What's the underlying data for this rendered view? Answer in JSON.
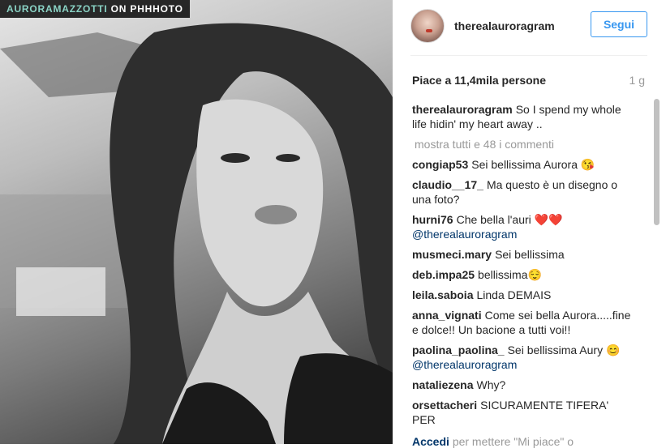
{
  "photo": {
    "overlay_tag_user": "AURORAMAZZOTTI",
    "overlay_tag_rest": "ON PHHHOTO"
  },
  "header": {
    "username": "therealauroragram",
    "follow_label": "Segui"
  },
  "likes": "Piace a 11,4mila persone",
  "time": "1 g",
  "caption": {
    "user": "therealauroragram",
    "text": "So I spend my whole life hidin' my heart away .."
  },
  "show_all": "mostra tutti e 48 i commenti",
  "comments": [
    {
      "user": "congiap53",
      "text": "Sei bellissima Aurora 😘"
    },
    {
      "user": "claudio__17_",
      "text": "Ma questo è un disegno o una foto?"
    },
    {
      "user": "hurni76",
      "text": "Che bella l'auri ❤️❤️",
      "mention": "@therealauroragram"
    },
    {
      "user": "musmeci.mary",
      "text": "Sei bellissima"
    },
    {
      "user": "deb.impa25",
      "text": "bellissima😌"
    },
    {
      "user": "leila.saboia",
      "text": "Linda DEMAIS"
    },
    {
      "user": "anna_vignati",
      "text": "Come sei bella Aurora.....fine e dolce!! Un bacione a tutti voi!!"
    },
    {
      "user": "paolina_paolina_",
      "text": "Sei bellissima Aury 😊",
      "mention": "@therealauroragram"
    },
    {
      "user": "nataliezena",
      "text": "Why?"
    },
    {
      "user": "orsettacheri",
      "text": "SICURAMENTE TIFERA' PER"
    }
  ],
  "bottom": {
    "link": "Accedi",
    "rest": "per mettere \"Mi piace\" o"
  }
}
